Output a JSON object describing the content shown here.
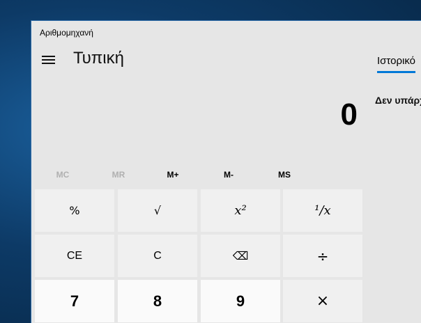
{
  "window": {
    "title": "Αριθμομηχανή"
  },
  "header": {
    "mode_title": "Τυπική"
  },
  "display": {
    "value": "0"
  },
  "history": {
    "tab_label": "Ιστορικό",
    "empty_message": "Δεν υπάρχ"
  },
  "memory": {
    "buttons": [
      "MC",
      "MR",
      "M+",
      "M-",
      "MS"
    ],
    "enabled": [
      false,
      false,
      true,
      true,
      true
    ]
  },
  "keys": {
    "percent": "%",
    "sqrt": "√",
    "square": "x²",
    "reciprocal": "¹/x",
    "ce": "CE",
    "c": "C",
    "backspace": "⌫",
    "divide": "÷",
    "seven": "7",
    "eight": "8",
    "nine": "9",
    "multiply": "×"
  },
  "colors": {
    "accent": "#0078d7",
    "window_bg": "#e6e6e6",
    "key_bg": "#f0f0f0",
    "digit_key_bg": "#fafafa",
    "disabled_text": "#b0b0b0"
  }
}
